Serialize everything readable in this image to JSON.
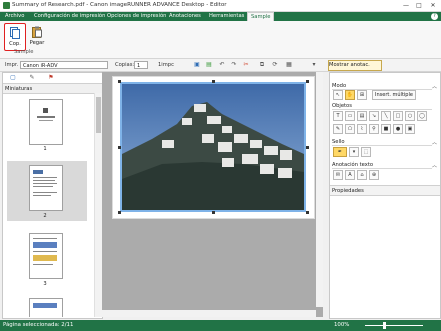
{
  "window": {
    "title": "Summary of Research.pdf - Canon imageRUNNER ADVANCE Desktop - Editor",
    "minimize": "—",
    "maximize": "□",
    "close": "✕"
  },
  "ribbon": {
    "tabs": [
      {
        "label": "Archivo"
      },
      {
        "label": "Configuración de impresión"
      },
      {
        "label": "Opciones de impresión"
      },
      {
        "label": "Anotaciones"
      },
      {
        "label": "Herramientas"
      },
      {
        "label": "Sample"
      }
    ],
    "active_tab": "Sample",
    "buttons": {
      "copy_label": "Cop.",
      "paste_label": "Pegar"
    },
    "group_label": "Sample"
  },
  "toolbar": {
    "printer_label": "Impr.",
    "printer_value": "Canon iR-ADV",
    "copies_label": "Copias:",
    "copies_value": "1",
    "duplex_label": "1impc",
    "stamp_button": "Mostrar anotac."
  },
  "left_panel": {
    "header": "Miniaturas",
    "pages": [
      "1",
      "2",
      "3"
    ],
    "selected_page": "2"
  },
  "right_panel": {
    "mode_label": "Modo",
    "insert_multiple": "Insert. múltiple",
    "objects_label": "Objetos",
    "stamp_label": "Sello",
    "text_annot_label": "Anotación texto",
    "properties_label": "Propiedades"
  },
  "status": {
    "page_text": "Página seleccionada: 2/11",
    "zoom": "100%"
  },
  "colors": {
    "accent": "#217346",
    "highlight": "#e02020",
    "selection": "#7fb3e8"
  },
  "icons": [
    "copy-icon",
    "paste-icon",
    "printer-icon",
    "thumbnails-icon",
    "comment-icon",
    "attachment-icon",
    "select-icon",
    "hand-icon",
    "rectangle-icon",
    "ellipse-icon",
    "line-icon",
    "stamp-icon",
    "text-icon"
  ]
}
